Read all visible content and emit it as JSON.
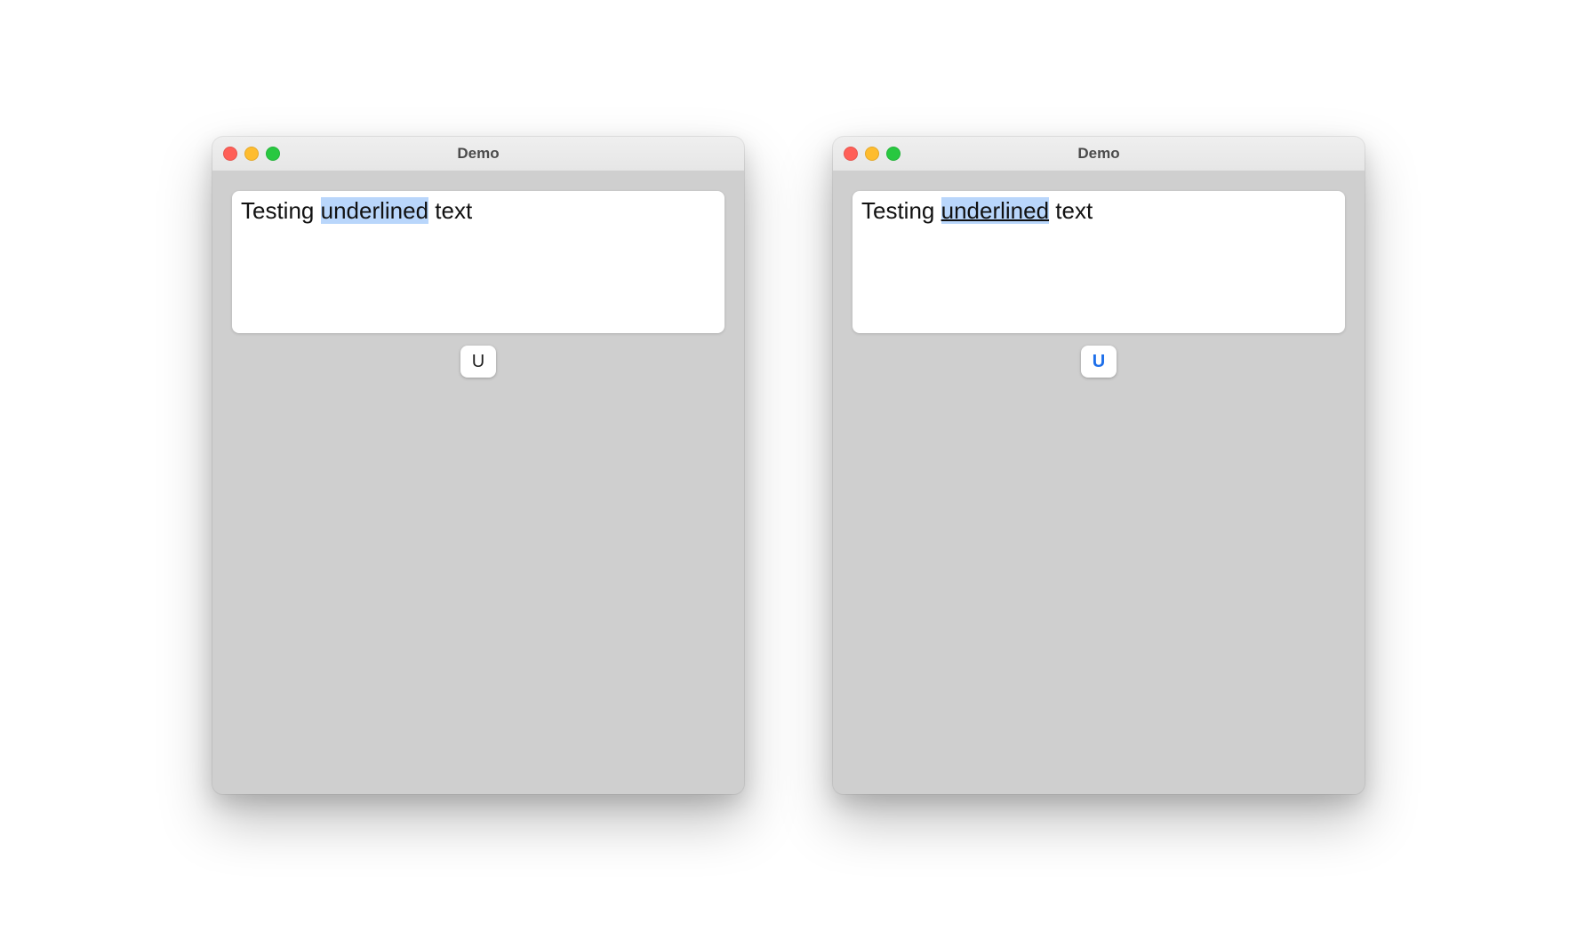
{
  "colors": {
    "selection": "#b9d6fb",
    "window_bg": "#cfcfcf",
    "titlebar_top": "#efefef",
    "titlebar_bottom": "#e6e6e6",
    "active_accent": "#1e6fea",
    "traffic_red": "#ff5f57",
    "traffic_yellow": "#febc2e",
    "traffic_green": "#28c840"
  },
  "left": {
    "title": "Demo",
    "text_before": "Testing ",
    "text_selected": "underlined",
    "text_after": " text",
    "selected_underlined": false,
    "button_label": "U",
    "button_active": false
  },
  "right": {
    "title": "Demo",
    "text_before": "Testing ",
    "text_selected": "underlined",
    "text_after": " text",
    "selected_underlined": true,
    "button_label": "U",
    "button_active": true
  }
}
